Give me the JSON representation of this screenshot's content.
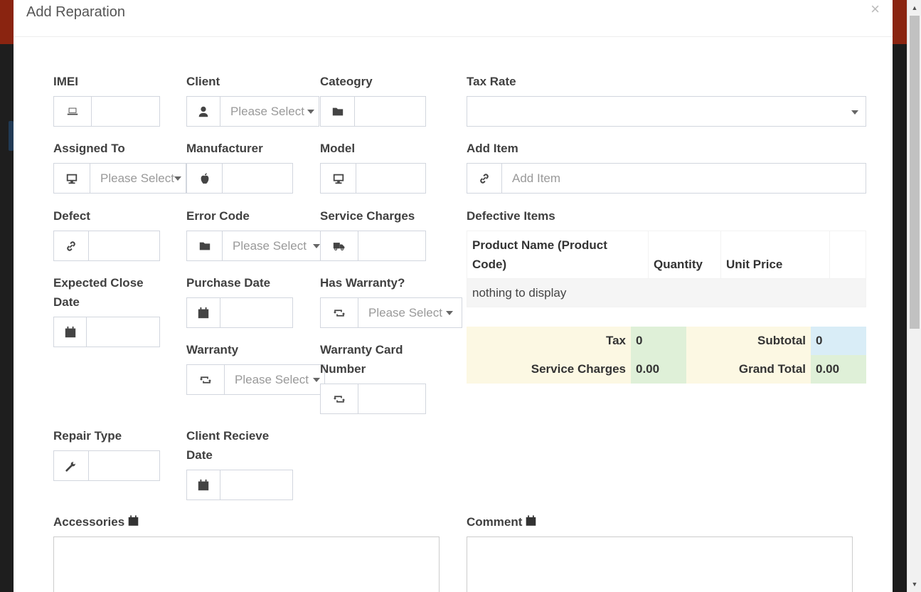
{
  "modal": {
    "title": "Add Reparation",
    "close_symbol": "×"
  },
  "form": {
    "imei": {
      "label": "IMEI",
      "value": ""
    },
    "client": {
      "label": "Client",
      "placeholder": "Please Select"
    },
    "category": {
      "label": "Cateogry",
      "value": ""
    },
    "tax_rate": {
      "label": "Tax Rate",
      "value": ""
    },
    "assigned_to": {
      "label": "Assigned To",
      "placeholder": "Please Select"
    },
    "manufacturer": {
      "label": "Manufacturer",
      "value": ""
    },
    "model": {
      "label": "Model",
      "value": ""
    },
    "add_item": {
      "label": "Add Item",
      "placeholder": "Add Item"
    },
    "defect": {
      "label": "Defect",
      "value": ""
    },
    "error_code": {
      "label": "Error Code",
      "placeholder": "Please Select"
    },
    "service_charges": {
      "label": "Service Charges",
      "value": ""
    },
    "expected_close_date": {
      "label": "Expected Close Date",
      "value": ""
    },
    "purchase_date": {
      "label": "Purchase Date",
      "value": ""
    },
    "has_warranty": {
      "label": "Has Warranty?",
      "placeholder": "Please Select"
    },
    "warranty": {
      "label": "Warranty",
      "placeholder": "Please Select"
    },
    "warranty_card_number": {
      "label": "Warranty Card Number",
      "value": ""
    },
    "repair_type": {
      "label": "Repair Type",
      "value": ""
    },
    "client_receive_date": {
      "label": "Client Recieve Date",
      "value": ""
    },
    "accessories": {
      "label": "Accessories",
      "value": ""
    },
    "comment": {
      "label": "Comment",
      "value": ""
    }
  },
  "defective_items": {
    "label": "Defective Items",
    "columns": [
      "Product Name (Product Code)",
      "Quantity",
      "Unit Price",
      ""
    ],
    "empty_text": "nothing to display"
  },
  "totals": {
    "tax_label": "Tax",
    "tax_value": "0",
    "subtotal_label": "Subtotal",
    "subtotal_value": "0",
    "service_charges_label": "Service Charges",
    "service_charges_value": "0.00",
    "grand_total_label": "Grand Total",
    "grand_total_value": "0.00"
  },
  "colors": {
    "backdrop_accent": "#8a2410",
    "totals_label_bg": "#fcf8e3",
    "totals_green_bg": "#dff0d8",
    "totals_blue_bg": "#d9edf7"
  }
}
